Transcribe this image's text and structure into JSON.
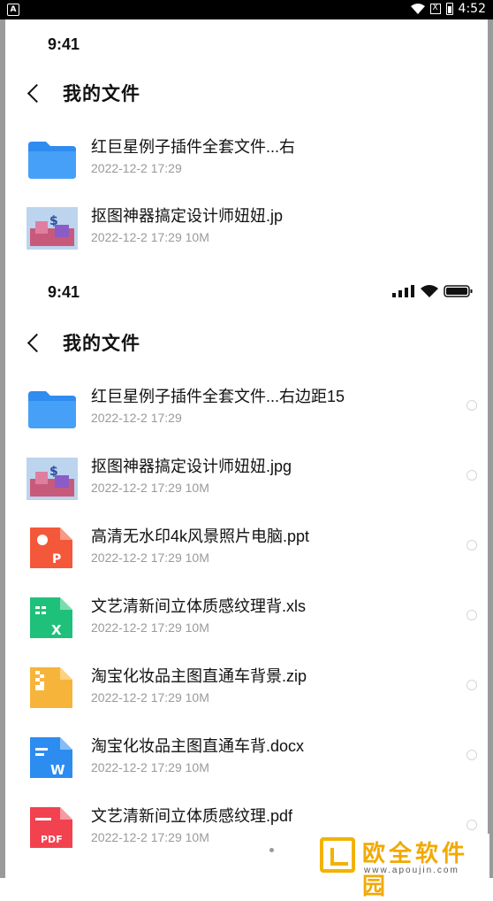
{
  "system_bar": {
    "left_badge": "A",
    "x_badge": "X",
    "time": "4:52"
  },
  "panel_top": {
    "time": "9:41",
    "title": "我的文件",
    "files": [
      {
        "name": "红巨星例子插件全套文件...右",
        "meta": "2022-12-2 17:29",
        "icon": "folder-icon"
      },
      {
        "name": "抠图神器搞定设计师妞妞.jp",
        "meta": "2022-12-2 17:29 10M",
        "icon": "image-icon"
      }
    ]
  },
  "panel_main": {
    "time": "9:41",
    "title": "我的文件",
    "files": [
      {
        "name": "红巨星例子插件全套文件...右边距15",
        "meta": "2022-12-2 17:29",
        "icon": "folder-icon"
      },
      {
        "name": "抠图神器搞定设计师妞妞.jpg",
        "meta": "2022-12-2 17:29 10M",
        "icon": "image-icon"
      },
      {
        "name": "高清无水印4k风景照片电脑.ppt",
        "meta": "2022-12-2 17:29 10M",
        "icon": "ppt-icon",
        "icon_letter": "P"
      },
      {
        "name": "文艺清新间立体质感纹理背.xls",
        "meta": "2022-12-2 17:29 10M",
        "icon": "xls-icon",
        "icon_letter": "X"
      },
      {
        "name": "淘宝化妆品主图直通车背景.zip",
        "meta": "2022-12-2 17:29 10M",
        "icon": "zip-icon"
      },
      {
        "name": "淘宝化妆品主图直通车背.docx",
        "meta": "2022-12-2 17:29 10M",
        "icon": "doc-icon",
        "icon_letter": "W"
      },
      {
        "name": "文艺清新间立体质感纹理.pdf",
        "meta": "2022-12-2 17:29 10M",
        "icon": "pdf-icon",
        "icon_letter": "PDF"
      }
    ]
  },
  "watermark": {
    "text": "欧全软件园",
    "url": "www.apoujin.com"
  },
  "colors": {
    "folder": "#2f8cf0",
    "ppt": "#f4583a",
    "xls": "#1fc07a",
    "zip": "#f7b43a",
    "doc": "#2d8cf0",
    "pdf": "#f2424f",
    "watermark": "#f2a900"
  }
}
